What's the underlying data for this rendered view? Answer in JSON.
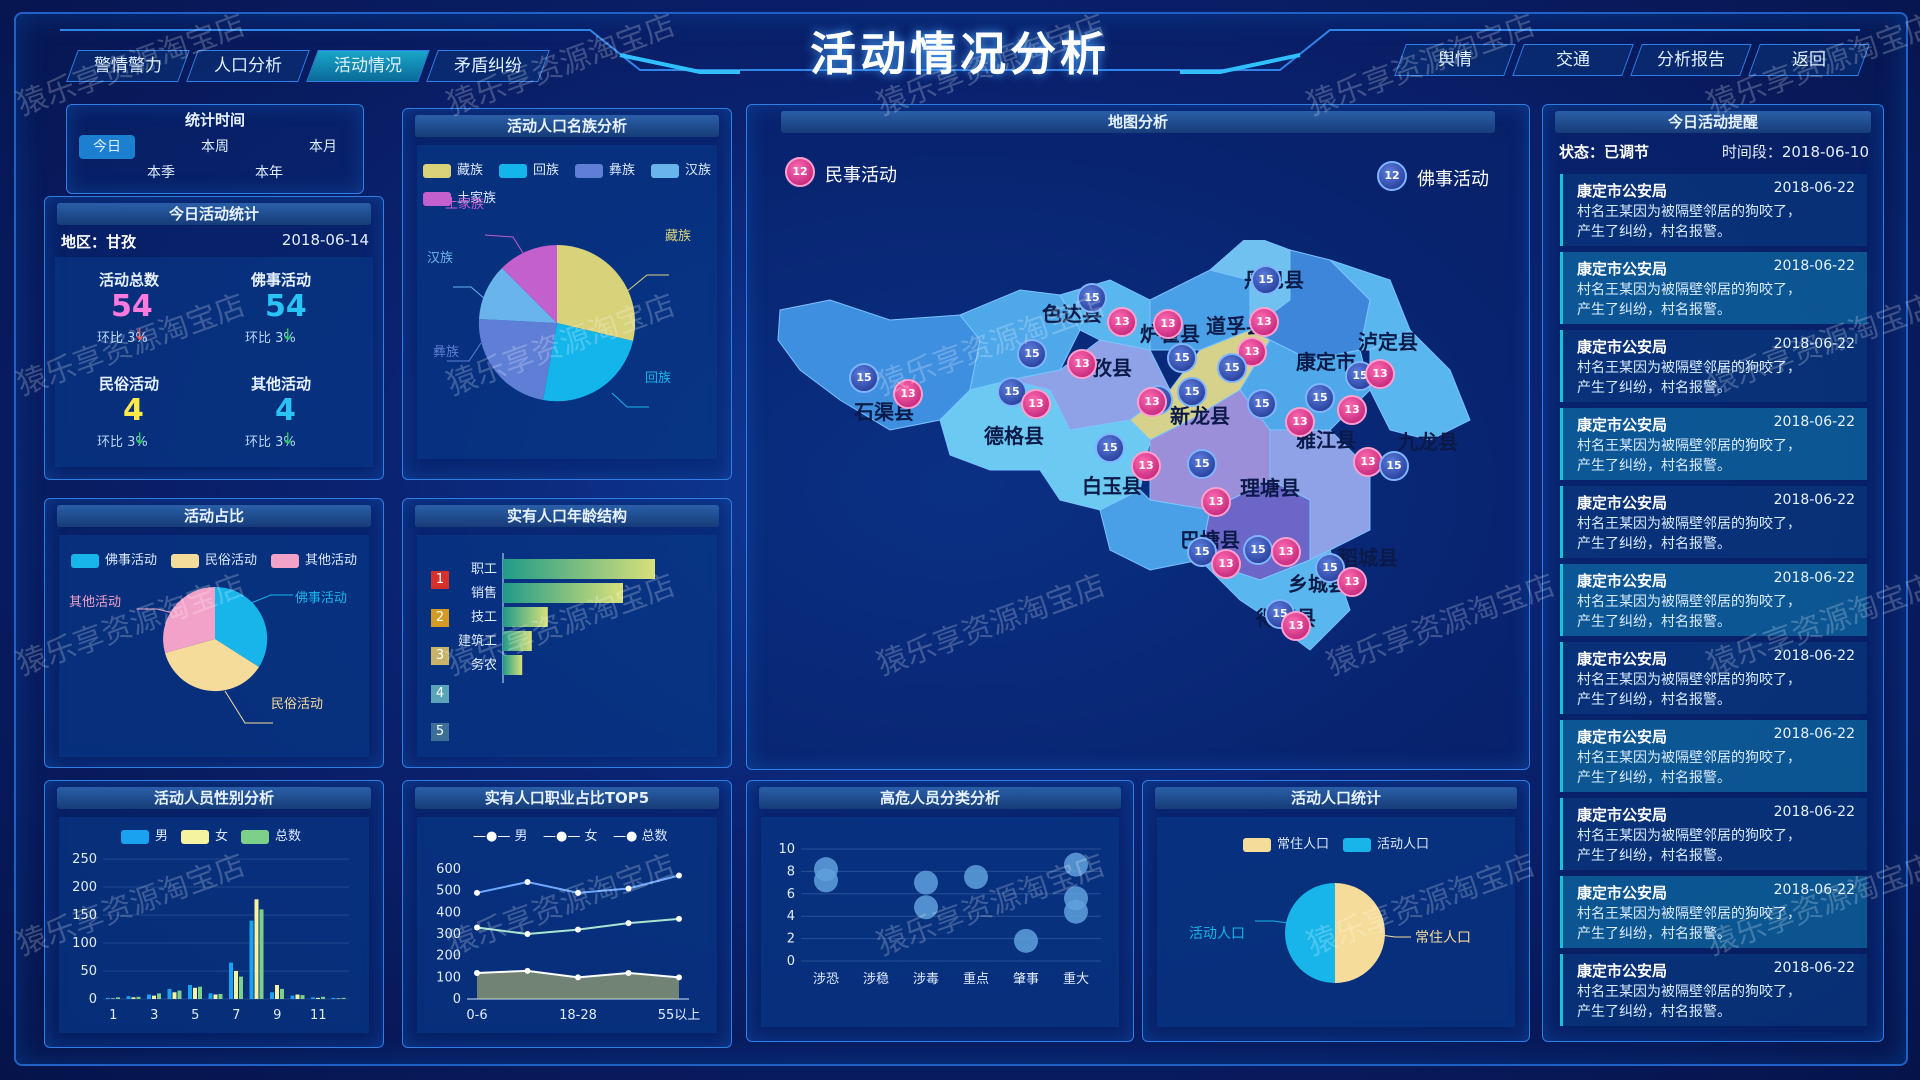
{
  "header": {
    "title": "活动情况分析",
    "left_tabs": [
      "警情警力",
      "人口分析",
      "活动情况",
      "矛盾纠纷"
    ],
    "active_tab": "活动情况",
    "right_tabs": [
      "舆情",
      "交通",
      "分析报告",
      "返回"
    ]
  },
  "stat_time": {
    "title": "统计时间",
    "options_row1": [
      "今日",
      "本周",
      "本月"
    ],
    "options_row2": [
      "本季",
      "本年"
    ],
    "selected": "今日"
  },
  "today_stats": {
    "title": "今日活动统计",
    "region": "地区：甘孜",
    "date": "2018-06-14",
    "items": [
      {
        "label": "活动总数",
        "value": "54",
        "change": "环比 3%",
        "color": "#ff7adf",
        "trend": "down-red"
      },
      {
        "label": "佛事活动",
        "value": "54",
        "change": "环比 3%",
        "color": "#28c4f5",
        "trend": "down-green"
      },
      {
        "label": "民俗活动",
        "value": "4",
        "change": "环比 3%",
        "color": "#ffe94a",
        "trend": "down-green"
      },
      {
        "label": "其他活动",
        "value": "4",
        "change": "环比 3%",
        "color": "#28c4f5",
        "trend": "down-green"
      }
    ]
  },
  "ethnic": {
    "title": "活动人口名族分析",
    "legend": [
      "藏族",
      "回族",
      "彝族",
      "汉族",
      "土家族"
    ],
    "colors": [
      "#d8d27a",
      "#14b5ea",
      "#5f7fd6",
      "#6ab4ec",
      "#c45fce"
    ],
    "slice_labels": [
      "藏族",
      "回族",
      "彝族",
      "汉族",
      "土家族"
    ]
  },
  "map": {
    "title": "地图分析",
    "legend_left_count": "12",
    "legend_left": "民事活动",
    "legend_right_count": "12",
    "legend_right": "佛事活动",
    "counties": [
      "丹巴县",
      "色达县",
      "炉霍县",
      "道孚县",
      "泸定县",
      "甘孜县",
      "康定市",
      "石渠县",
      "新龙县",
      "德格县",
      "雅江县",
      "九龙县",
      "白玉县",
      "理塘县",
      "巴塘县",
      "乡城县",
      "稻城县",
      "得荣县"
    ],
    "pin_blue": "15",
    "pin_pink": "13"
  },
  "reminders": {
    "title": "今日活动提醒",
    "status": "状态：已调节",
    "period": "时间段：2018-06-10",
    "items": [
      {
        "org": "康定市公安局",
        "date": "2018-06-22",
        "text": "村名王某因为被隔壁邻居的狗咬了，产生了纠纷，村名报警。"
      },
      {
        "org": "康定市公安局",
        "date": "2018-06-22",
        "text": "村名王某因为被隔壁邻居的狗咬了，产生了纠纷，村名报警。"
      },
      {
        "org": "康定市公安局",
        "date": "2018-06-22",
        "text": "村名王某因为被隔壁邻居的狗咬了，产生了纠纷，村名报警。"
      },
      {
        "org": "康定市公安局",
        "date": "2018-06-22",
        "text": "村名王某因为被隔壁邻居的狗咬了，产生了纠纷，村名报警。"
      },
      {
        "org": "康定市公安局",
        "date": "2018-06-22",
        "text": "村名王某因为被隔壁邻居的狗咬了，产生了纠纷，村名报警。"
      },
      {
        "org": "康定市公安局",
        "date": "2018-06-22",
        "text": "村名王某因为被隔壁邻居的狗咬了，产生了纠纷，村名报警。"
      },
      {
        "org": "康定市公安局",
        "date": "2018-06-22",
        "text": "村名王某因为被隔壁邻居的狗咬了，产生了纠纷，村名报警。"
      },
      {
        "org": "康定市公安局",
        "date": "2018-06-22",
        "text": "村名王某因为被隔壁邻居的狗咬了，产生了纠纷，村名报警。"
      },
      {
        "org": "康定市公安局",
        "date": "2018-06-22",
        "text": "村名王某因为被隔壁邻居的狗咬了，产生了纠纷，村名报警。"
      },
      {
        "org": "康定市公安局",
        "date": "2018-06-22",
        "text": "村名王某因为被隔壁邻居的狗咬了，产生了纠纷，村名报警。"
      },
      {
        "org": "康定市公安局",
        "date": "2018-06-22",
        "text": "村名王某因为被隔壁邻居的狗咬了，产生了纠纷，村名报警。"
      }
    ]
  },
  "activity_ratio": {
    "title": "活动占比",
    "legend": [
      "佛事活动",
      "民俗活动",
      "其他活动"
    ],
    "colors": [
      "#17b5ea",
      "#f6dc9a",
      "#f2a2c8"
    ]
  },
  "age_structure": {
    "title": "实有人口年龄结构",
    "ranks": [
      "1",
      "2",
      "3",
      "4",
      "5"
    ],
    "rank_colors": [
      "#d6302a",
      "#d49a24",
      "#c9b36a",
      "#5aa3b8",
      "#3d6e98"
    ],
    "categories": [
      "职工",
      "销售",
      "技工",
      "建筑工",
      "务农"
    ],
    "values": [
      95,
      75,
      28,
      18,
      12
    ]
  },
  "gender": {
    "title": "活动人员性别分析",
    "legend": [
      "男",
      "女",
      "总数"
    ],
    "colors": [
      "#1aa2f0",
      "#f6f3a0",
      "#7cd08a"
    ],
    "y_ticks": [
      "250",
      "200",
      "150",
      "100",
      "50",
      "0"
    ],
    "x_ticks": [
      "1",
      "3",
      "5",
      "7",
      "9",
      "11"
    ],
    "male": [
      2,
      5,
      8,
      18,
      25,
      10,
      65,
      140,
      12,
      6,
      3,
      2
    ],
    "female": [
      1,
      3,
      6,
      12,
      20,
      8,
      50,
      178,
      25,
      8,
      2,
      1
    ],
    "total": [
      3,
      4,
      10,
      15,
      22,
      9,
      40,
      160,
      18,
      7,
      4,
      2
    ]
  },
  "occupation": {
    "title": "实有人口职业占比TOP5",
    "legend": [
      "男",
      "女",
      "总数"
    ],
    "y_ticks": [
      "600",
      "500",
      "400",
      "300",
      "200",
      "100",
      "0"
    ],
    "x_ticks": [
      "0-6",
      "18-28",
      "55以上"
    ],
    "male": [
      490,
      540,
      490,
      510,
      570
    ],
    "female": [
      330,
      300,
      320,
      350,
      370
    ],
    "total": [
      120,
      130,
      100,
      120,
      100
    ]
  },
  "high_risk": {
    "title": "高危人员分类分析",
    "y_ticks": [
      "10",
      "8",
      "6",
      "4",
      "2",
      "0"
    ],
    "categories": [
      "涉恐",
      "涉稳",
      "涉毒",
      "重点",
      "肇事",
      "重大"
    ],
    "points": [
      [
        0,
        8.2
      ],
      [
        0,
        7.2
      ],
      [
        2,
        7.0
      ],
      [
        2,
        4.8
      ],
      [
        3,
        7.5
      ],
      [
        4,
        1.8
      ],
      [
        5,
        8.6
      ],
      [
        5,
        5.6
      ],
      [
        5,
        4.4
      ]
    ]
  },
  "population": {
    "title": "活动人口统计",
    "legend": [
      "常住人口",
      "活动人口"
    ],
    "colors": [
      "#f6dc9a",
      "#17b5ea"
    ],
    "label_left": "活动人口",
    "label_right": "常住人口"
  },
  "watermark": "猿乐享资源淘宝店"
}
